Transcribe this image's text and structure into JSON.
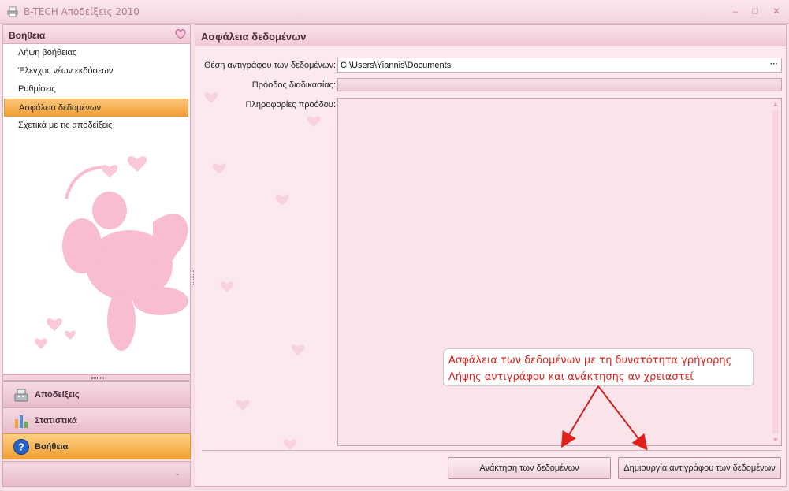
{
  "window": {
    "title": "B-TECH Αποδείξεις 2010",
    "minimize_glyph": "–",
    "maximize_glyph": "□",
    "close_glyph": "✕"
  },
  "sidebar": {
    "header": "Βοήθεια",
    "items": [
      {
        "label": "Λήψη βοήθειας"
      },
      {
        "label": "Έλεγχος νέων εκδόσεων"
      },
      {
        "label": "Ρυθμίσεις"
      },
      {
        "label": "Ασφάλεια δεδομένων",
        "active": true
      },
      {
        "label": "Σχετικά με τις αποδείξεις"
      }
    ]
  },
  "bottom_nav": {
    "receipts": "Αποδείξεις",
    "statistics": "Στατιστικά",
    "help": "Βοήθεια",
    "chevron": "⌄"
  },
  "main": {
    "header": "Ασφάλεια δεδομένων",
    "copy_location_label": "Θέση αντιγράφου των δεδομένων:",
    "copy_location_value": "C:\\Users\\Yiannis\\Documents",
    "browse_glyph": "···",
    "progress_label": "Πρόοδος διαδικασίας:",
    "progress_value": 0,
    "info_label": "Πληροφορίες προόδου:",
    "restore_button": "Ανάκτηση των δεδομένων",
    "backup_button": "Δημιουργία αντιγράφου των δεδομένων"
  },
  "callout": {
    "line1": "Ασφάλεια των δεδομένων με τη δυνατότητα γρήγορης",
    "line2": "Λήψης αντιγράφου και ανάκτησης αν χρειαστεί"
  },
  "colors": {
    "accent_orange": "#f3a032",
    "pink_bg": "#fbe9ee",
    "callout_text": "#e2211c"
  }
}
